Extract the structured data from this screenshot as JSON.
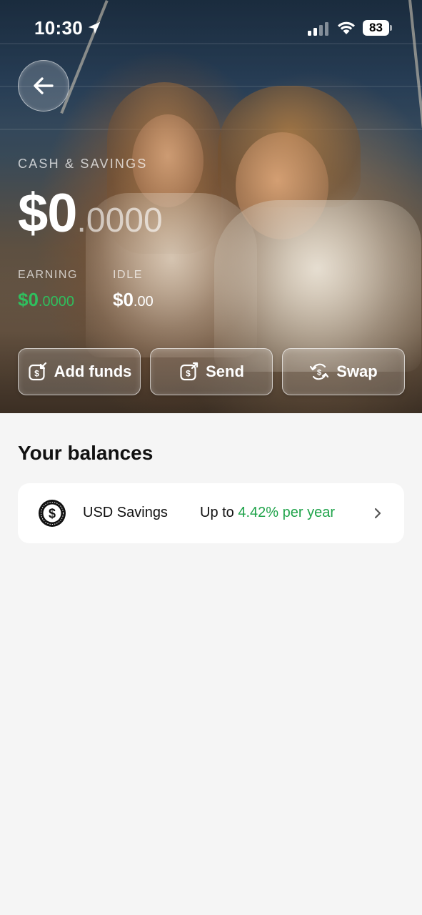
{
  "status_bar": {
    "time": "10:30",
    "battery": "83"
  },
  "hero": {
    "label": "CASH & SAVINGS",
    "amount_main": "$0",
    "amount_decimal": ".0000",
    "earning": {
      "label": "EARNING",
      "value_main": "$0",
      "value_decimal": ".0000",
      "color": "#2fbf5e"
    },
    "idle": {
      "label": "IDLE",
      "value_main": "$0",
      "value_decimal": ".00"
    },
    "actions": [
      {
        "label": "Add funds",
        "icon": "add-funds-icon"
      },
      {
        "label": "Send",
        "icon": "send-icon"
      },
      {
        "label": "Swap",
        "icon": "swap-icon"
      }
    ]
  },
  "balances": {
    "title": "Your balances",
    "items": [
      {
        "name": "USD Savings",
        "rate_prefix": "Up to ",
        "rate_value": "4.42% per year",
        "icon": "dollar-coin-icon",
        "accent_color": "#1fa34a"
      }
    ]
  }
}
